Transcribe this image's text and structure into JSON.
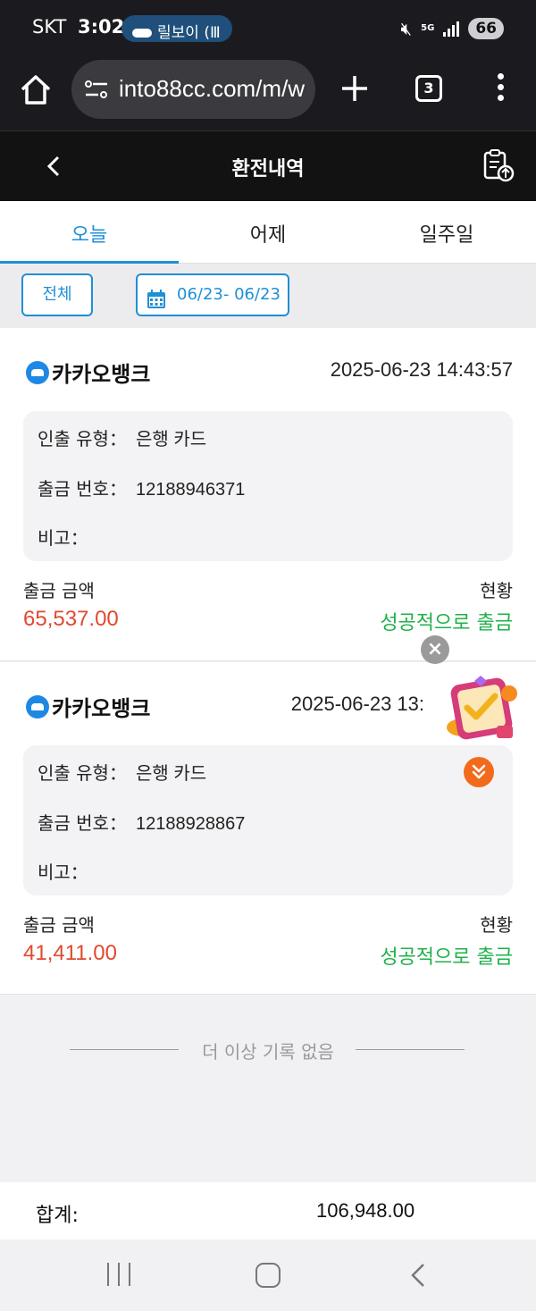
{
  "status_bar": {
    "carrier": "SKT",
    "time": "3:02",
    "notification": "릴보이 (Ⅲ",
    "network": "5G",
    "battery": "66"
  },
  "browser": {
    "url": "into88cc.com/m/w",
    "tab_count": "3"
  },
  "header": {
    "title": "환전내역"
  },
  "tabs": [
    {
      "label": "오늘",
      "active": true
    },
    {
      "label": "어제",
      "active": false
    },
    {
      "label": "일주일",
      "active": false
    }
  ],
  "filter": {
    "all_label": "전체",
    "date_range": "06/23- 06/23"
  },
  "labels": {
    "withdraw_type": "인출 유형：",
    "withdraw_no": "출금 번호：",
    "memo": "비고：",
    "amount": "출금 금액",
    "status": "현황"
  },
  "records": [
    {
      "bank": "카카오뱅크",
      "datetime": "2025-06-23 14:43:57",
      "type": "은행 카드",
      "number": "12188946371",
      "memo": "",
      "amount": "65,537.00",
      "status": "성공적으로 출금"
    },
    {
      "bank": "카카오뱅크",
      "datetime": "2025-06-23 13:",
      "type": "은행 카드",
      "number": "12188928867",
      "memo": "",
      "amount": "41,411.00",
      "status": "성공적으로 출금"
    }
  ],
  "end_text": "더 이상 기록 없음",
  "total": {
    "label": "합계:",
    "value": "106,948.00"
  },
  "icons": {
    "home": "home-icon",
    "site_info": "site-settings-icon",
    "new_tab": "plus-icon",
    "menu": "more-vert-icon",
    "back": "chevron-left-icon",
    "clipboard": "clipboard-upload-icon",
    "calendar": "calendar-icon",
    "close": "close-icon",
    "expand": "double-chevron-down-icon"
  },
  "colors": {
    "accent": "#1f8fd6",
    "amount": "#e04a2f",
    "success": "#1fb14a",
    "header_bg": "#121212"
  }
}
